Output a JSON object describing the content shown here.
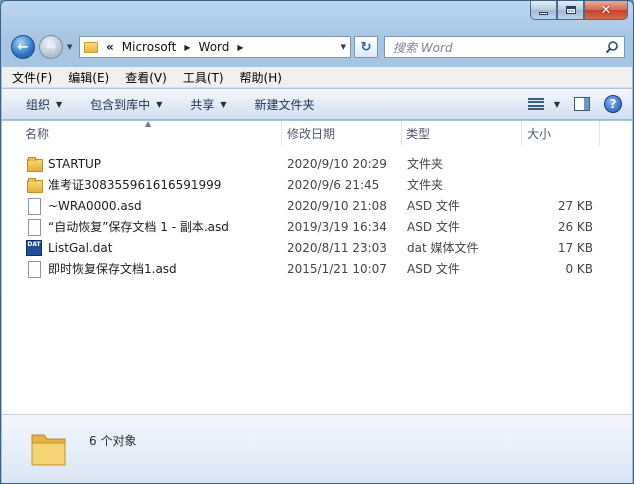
{
  "window": {
    "controls": {
      "minimize": "–",
      "maximize": "□",
      "close": "✕"
    }
  },
  "nav": {
    "back_glyph": "←",
    "forward_glyph": "→",
    "breadcrumb": {
      "overflow": "«",
      "items": [
        "Microsoft",
        "Word"
      ]
    },
    "refresh_glyph": "↻",
    "search_placeholder": "搜索 Word"
  },
  "menubar": [
    "文件(F)",
    "编辑(E)",
    "查看(V)",
    "工具(T)",
    "帮助(H)"
  ],
  "toolbar": {
    "organize": "组织",
    "include_in_library": "包含到库中",
    "share": "共享",
    "new_folder": "新建文件夹",
    "help_glyph": "?"
  },
  "columns": {
    "name": "名称",
    "modified": "修改日期",
    "type": "类型",
    "size": "大小"
  },
  "files": [
    {
      "icon": "folder-icon",
      "name": "STARTUP",
      "modified": "2020/9/10 20:29",
      "type": "文件夹",
      "size": ""
    },
    {
      "icon": "folder-icon",
      "name": "准考证308355961616591999",
      "modified": "2020/9/6 21:45",
      "type": "文件夹",
      "size": ""
    },
    {
      "icon": "document-icon",
      "name": "~WRA0000.asd",
      "modified": "2020/9/10 21:08",
      "type": "ASD 文件",
      "size": "27 KB"
    },
    {
      "icon": "document-icon",
      "name": "“自动恢复”保存文档 1 - 副本.asd",
      "modified": "2019/3/19 16:34",
      "type": "ASD 文件",
      "size": "26 KB"
    },
    {
      "icon": "dat-file-icon",
      "name": "ListGal.dat",
      "modified": "2020/8/11 23:03",
      "type": "dat 媒体文件",
      "size": "17 KB"
    },
    {
      "icon": "document-icon",
      "name": "即时恢复保存文档1.asd",
      "modified": "2015/1/21 10:07",
      "type": "ASD 文件",
      "size": "0 KB"
    }
  ],
  "details": {
    "status": "6 个对象"
  },
  "colors": {
    "accent": "#3b5f85",
    "toolbar": "#dbe6f4",
    "folder": "#e2ae3b"
  }
}
